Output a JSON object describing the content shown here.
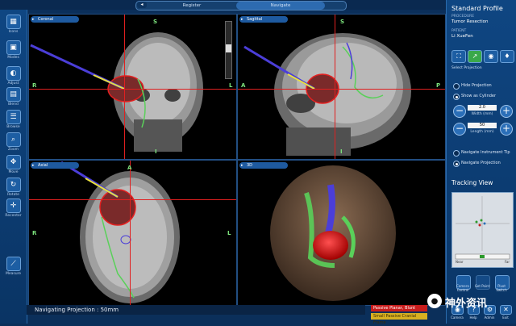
{
  "top_tabs": {
    "back": "◂",
    "register": "Register",
    "navigate": "Navigate"
  },
  "left_tools": [
    {
      "icon": "icons-icon",
      "label": "Icons"
    },
    {
      "icon": "modes-icon",
      "label": "Modes"
    },
    {
      "icon": "adjust-icon",
      "label": "Adjust"
    },
    {
      "icon": "blend-icon",
      "label": "Blend"
    },
    {
      "icon": "browse-icon",
      "label": "Browse"
    },
    {
      "icon": "zoom-icon",
      "label": "Zoom"
    },
    {
      "icon": "move-icon",
      "label": "Move"
    },
    {
      "icon": "rotate-icon",
      "label": "Rotate"
    },
    {
      "icon": "recenter-icon",
      "label": "Recenter"
    },
    {
      "icon": "measure-icon",
      "label": "Measure"
    }
  ],
  "views": {
    "coronal": {
      "label": "Coronal",
      "top": "S",
      "bottom": "I",
      "left": "R",
      "right": "L"
    },
    "sagittal": {
      "label": "Sagittal",
      "top": "S",
      "bottom": "I",
      "left": "A",
      "right": "P"
    },
    "axial": {
      "label": "Axial",
      "top": "A",
      "left": "R",
      "right": "L"
    },
    "threed": {
      "label": "3D"
    }
  },
  "status": {
    "text": "Navigating Projection : 50mm"
  },
  "instruments": {
    "primary": "Passive Planar, Blunt",
    "secondary": "Small Passive Cranial Frame"
  },
  "profile": {
    "title": "Standard Profile",
    "procedure_label": "PROCEDURE",
    "procedure": "Tumor Resection",
    "patient_label": "PATIENT",
    "patient": "Li XueFen"
  },
  "projection": {
    "section_label": "Select Projection",
    "hide": "Hide Projection",
    "show_cylinder": "Show as Cylinder",
    "width_value": "2.0",
    "width_label": "Width (mm)",
    "length_value": "50",
    "length_label": "Length (mm)",
    "nav_tip": "Navigate Instrument Tip",
    "nav_proj": "Navigate Projection"
  },
  "tracking": {
    "title": "Tracking View",
    "left_label": "Near",
    "right_label": "Far"
  },
  "bottom_buttons": [
    {
      "label": "Camera"
    },
    {
      "label": "Help"
    },
    {
      "label": "Admin"
    },
    {
      "label": "Exit"
    }
  ],
  "action_buttons": {
    "left": "Camera Control",
    "middle": "Get Point",
    "right": "Pivot Switch"
  },
  "watermark": "神外资讯",
  "colors": {
    "accent": "#2d6bb0",
    "crosshair": "#e02020",
    "tumor": "#d01818",
    "fibers": "#5ad05a"
  }
}
